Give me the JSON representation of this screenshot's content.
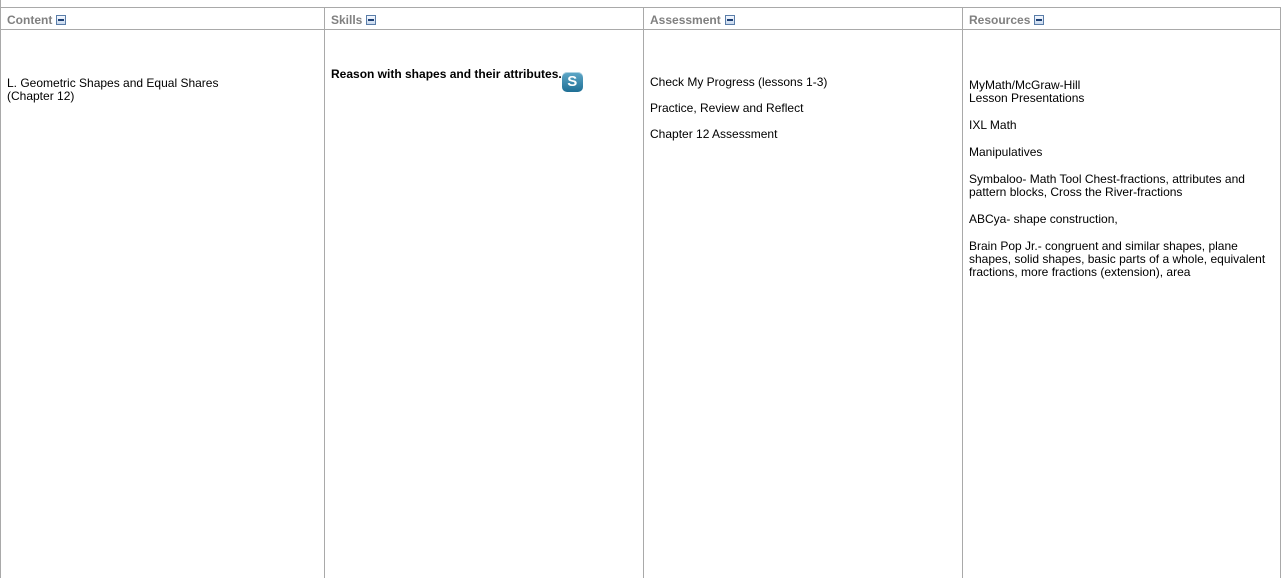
{
  "headers": {
    "content": "Content",
    "skills": "Skills",
    "assessment": "Assessment",
    "resources": "Resources"
  },
  "content": {
    "line1": "L. Geometric Shapes and Equal Shares",
    "line2": "(Chapter 12)"
  },
  "skills": {
    "text": "Reason with shapes and their attributes.",
    "icon_glyph": "S",
    "icon_name": "standards-icon"
  },
  "assessment": {
    "items": [
      "Check My Progress (lessons 1-3)",
      "Practice, Review and Reflect",
      "Chapter 12 Assessment"
    ]
  },
  "resources": {
    "mymath_line1": "MyMath/McGraw-Hill",
    "mymath_line2": "Lesson Presentations",
    "ixl": "IXL Math",
    "manipulatives": "Manipulatives",
    "symbaloo": "Symbaloo- Math Tool Chest-fractions, attributes and pattern blocks, Cross the River-fractions",
    "abcya": "ABCya- shape construction,",
    "brainpop": "Brain Pop Jr.- congruent and similar shapes, plane shapes, solid shapes, basic parts of a whole, equivalent fractions, more fractions (extension), area"
  },
  "colors": {
    "border": "#a9a9a9",
    "header_text": "#808080",
    "icon_blue": "#1f6f95"
  }
}
